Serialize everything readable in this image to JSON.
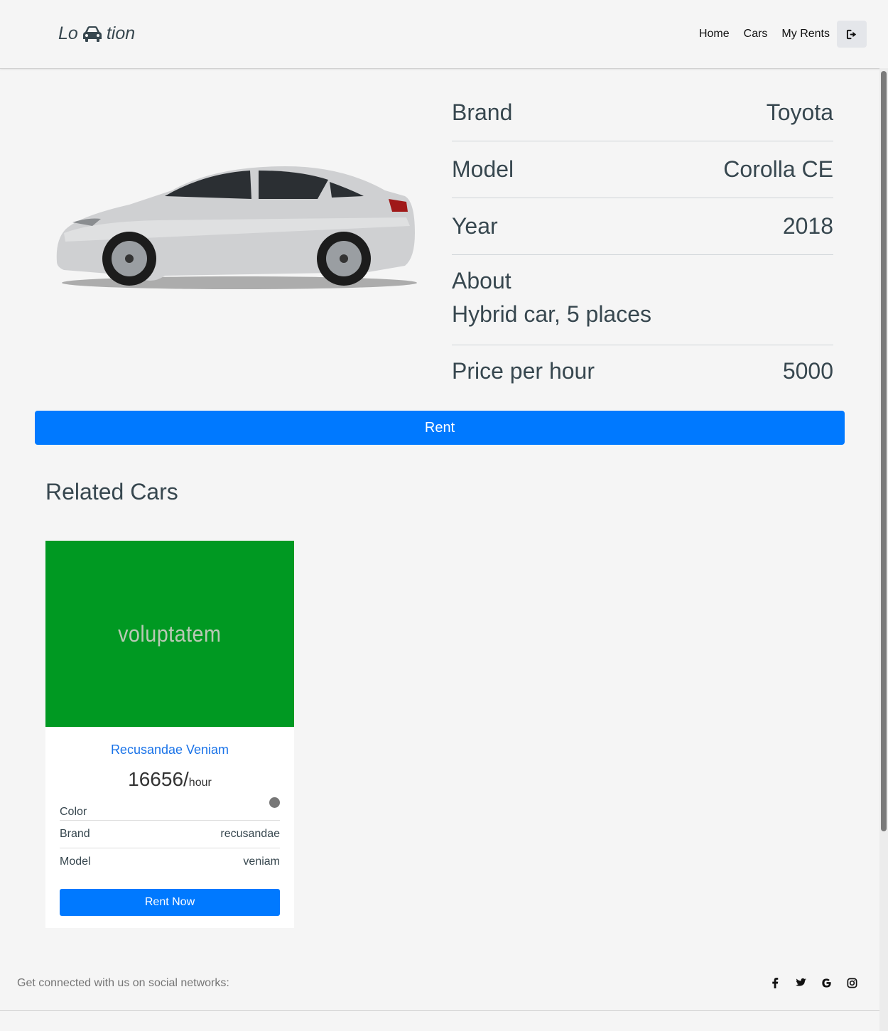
{
  "nav": {
    "brand_left": "Lo",
    "brand_right": "tion",
    "brand_icon": "car-icon",
    "links": [
      "Home",
      "Cars",
      "My Rents"
    ],
    "logout_icon": "sign-out-icon"
  },
  "car": {
    "image": "silver-sedan-image",
    "rows": [
      {
        "label": "Brand",
        "value": "Toyota"
      },
      {
        "label": "Model",
        "value": "Corolla CE"
      },
      {
        "label": "Year",
        "value": "2018"
      }
    ],
    "about_label": "About",
    "about_text": "Hybrid car, 5 places",
    "price_label": "Price per hour",
    "price_value": "5000"
  },
  "rent_button": "Rent",
  "related": {
    "title": "Related Cars",
    "cards": [
      {
        "image_text": "voluptatem",
        "image_color": "#009922",
        "title": "Recusandae Veniam",
        "price": "16656/",
        "price_unit": "hour",
        "color_label": "Color",
        "color_value": "#777777",
        "brand_label": "Brand",
        "brand_value": "recusandae",
        "model_label": "Model",
        "model_value": "veniam",
        "button": "Rent Now"
      }
    ]
  },
  "footer": {
    "text": "Get connected with us on social networks:",
    "socials": [
      "facebook-icon",
      "twitter-icon",
      "google-icon",
      "instagram-icon"
    ]
  },
  "colors": {
    "primary": "#0079ff",
    "text": "#37474f",
    "background": "#f5f5f5",
    "link": "#1a73e8"
  }
}
